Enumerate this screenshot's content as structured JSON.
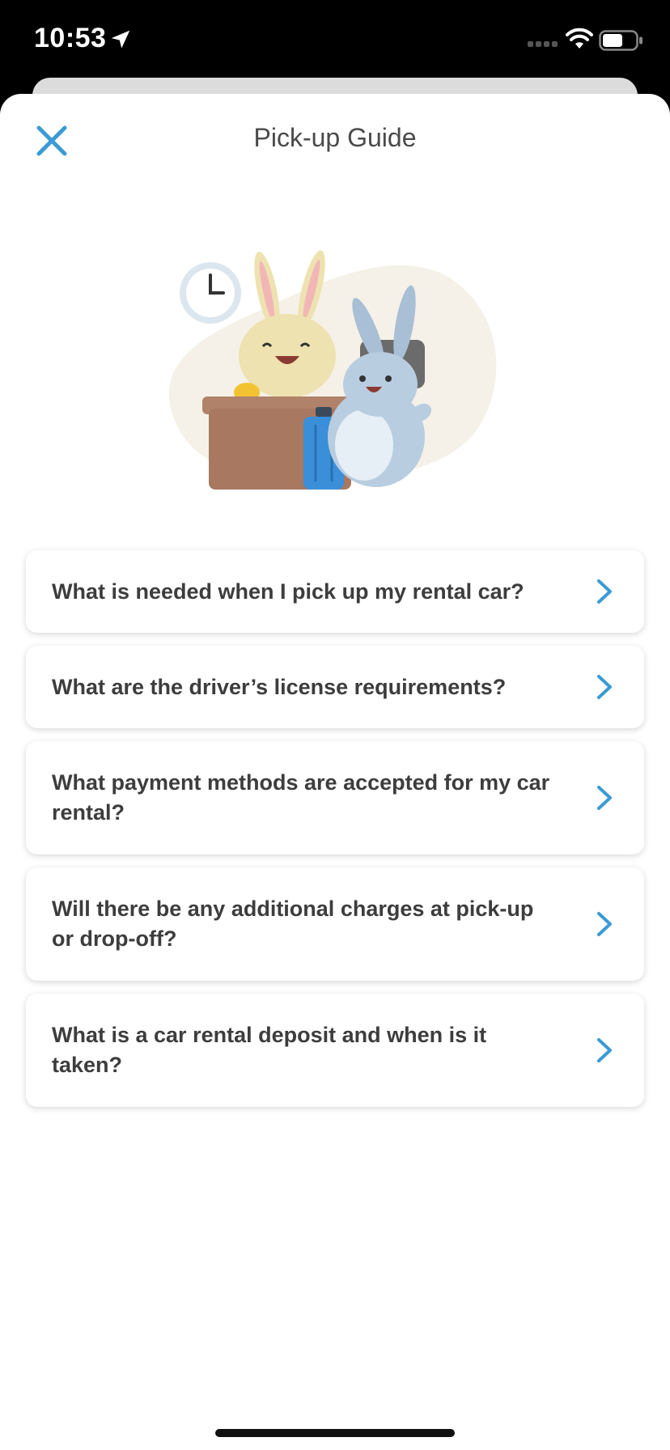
{
  "status_bar": {
    "time": "10:53"
  },
  "header": {
    "title": "Pick-up Guide",
    "close_icon": "close-icon"
  },
  "faq": [
    {
      "question": "What is needed when I pick up my rental car?"
    },
    {
      "question": "What are the driver’s license requirements?"
    },
    {
      "question": "What payment methods are accepted for my car rental?"
    },
    {
      "question": "Will there be any additional charges at pick-up or drop-off?"
    },
    {
      "question": "What is a car rental deposit and when is it taken?"
    }
  ],
  "colors": {
    "accent": "#3a9bd5",
    "text": "#3d3d3d",
    "sheet": "#ffffff"
  }
}
